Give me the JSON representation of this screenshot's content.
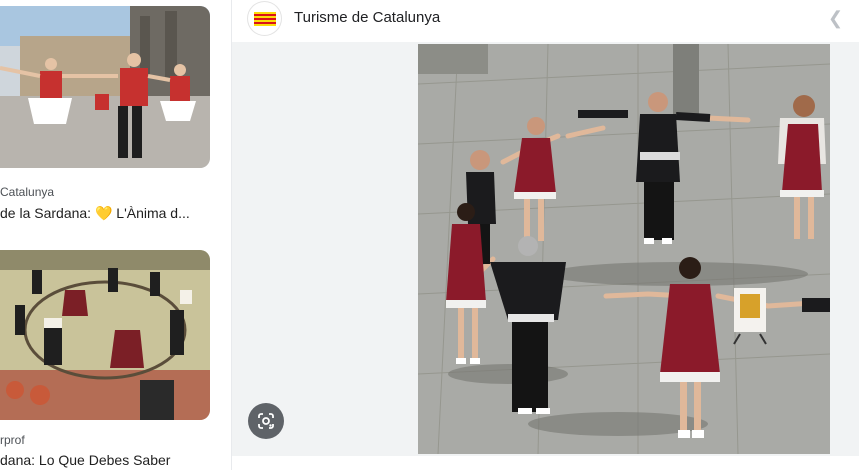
{
  "results": [
    {
      "source": "Catalunya",
      "title": "de la Sardana: 💛 L'Ànima d..."
    },
    {
      "source": "rprof",
      "title": "dana: Lo Que Debes Saber"
    }
  ],
  "preview": {
    "site_name": "Turisme de Catalunya",
    "favicon_icon": "catalan-flag-icon",
    "back_icon": "chevron-left-icon",
    "lens_icon": "google-lens-icon"
  },
  "colors": {
    "panel_bg": "#f1f3f4",
    "dress_red": "#8b1a2a",
    "lens_button": "#5f6368"
  }
}
